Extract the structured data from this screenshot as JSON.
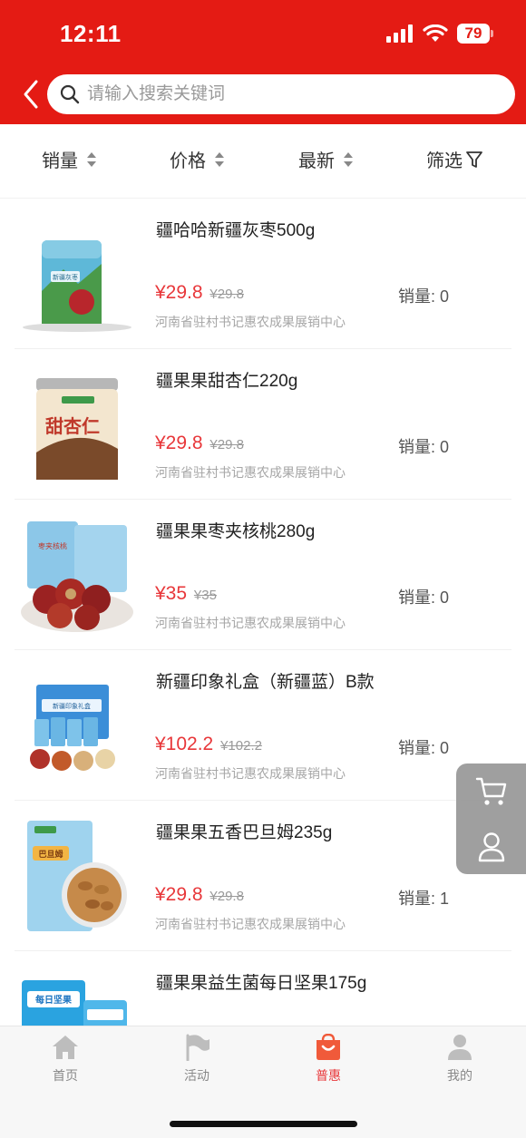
{
  "status": {
    "time": "12:11",
    "battery": "79"
  },
  "search": {
    "placeholder": "请输入搜索关键词"
  },
  "sort": [
    {
      "label": "销量"
    },
    {
      "label": "价格"
    },
    {
      "label": "最新"
    },
    {
      "label": "筛选"
    }
  ],
  "products": [
    {
      "name": "疆哈哈新疆灰枣500g",
      "price": "¥29.8",
      "original_price": "¥29.8",
      "sales": "销量: 0",
      "store": "河南省驻村书记惠农成果展销中心"
    },
    {
      "name": "疆果果甜杏仁220g",
      "price": "¥29.8",
      "original_price": "¥29.8",
      "sales": "销量: 0",
      "store": "河南省驻村书记惠农成果展销中心"
    },
    {
      "name": "疆果果枣夹核桃280g",
      "price": "¥35",
      "original_price": "¥35",
      "sales": "销量: 0",
      "store": "河南省驻村书记惠农成果展销中心"
    },
    {
      "name": "新疆印象礼盒（新疆蓝）B款",
      "price": "¥102.2",
      "original_price": "¥102.2",
      "sales": "销量: 0",
      "store": "河南省驻村书记惠农成果展销中心"
    },
    {
      "name": "疆果果五香巴旦姆235g",
      "price": "¥29.8",
      "original_price": "¥29.8",
      "sales": "销量: 1",
      "store": "河南省驻村书记惠农成果展销中心"
    },
    {
      "name": "疆果果益生菌每日坚果175g",
      "price": "",
      "original_price": "",
      "sales": "",
      "store": ""
    }
  ],
  "thumb_text": {
    "p1": "新疆灰枣",
    "p2": "甜杏仁",
    "p3": "枣夹核桃",
    "p4": "新疆印象礼盒",
    "p5": "巴旦姆",
    "p6": "每日坚果"
  },
  "tabs": [
    {
      "label": "首页",
      "icon": "home-icon"
    },
    {
      "label": "活动",
      "icon": "flag-icon"
    },
    {
      "label": "普惠",
      "icon": "shopping-bag-icon"
    },
    {
      "label": "我的",
      "icon": "user-icon"
    }
  ],
  "colors": {
    "brand_red": "#e41b14",
    "price_red": "#e8373a",
    "float_gray": "#9a9a9a"
  }
}
